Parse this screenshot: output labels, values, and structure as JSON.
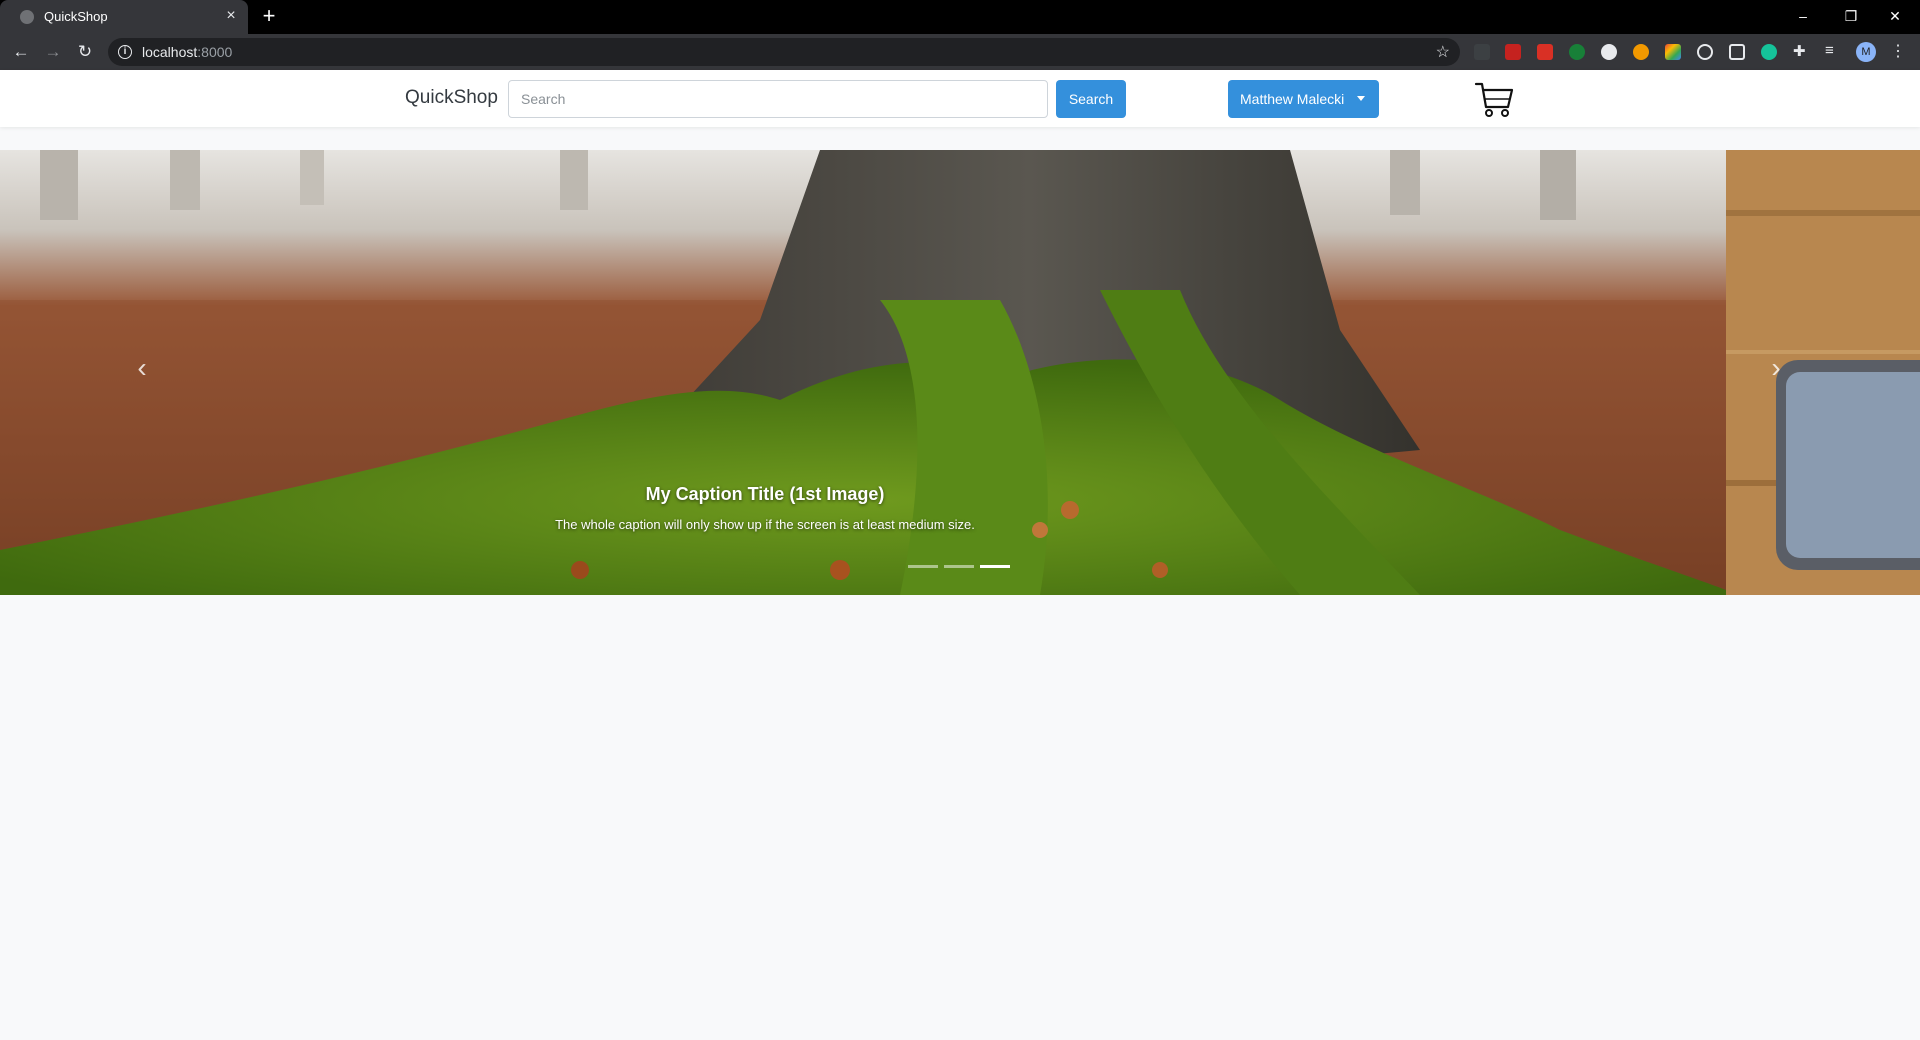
{
  "browser": {
    "tab_title": "QuickShop",
    "tab_close": "×",
    "new_tab": "+",
    "url_host": "localhost",
    "url_port": ":8000",
    "window_controls": {
      "minimize": "–",
      "restore": "❐",
      "close": "✕"
    },
    "profile_initial": "M"
  },
  "navbar": {
    "brand": "QuickShop",
    "search_placeholder": "Search",
    "search_button": "Search",
    "user_name": "Matthew Malecki",
    "cart_icon": "shopping-cart-icon"
  },
  "carousel": {
    "caption_title": "My Caption Title (1st Image)",
    "caption_text": "The whole caption will only show up if the screen is at least medium size.",
    "indicator_count": 3,
    "active_indicator": 3,
    "prev_icon": "chevron-left-icon",
    "next_icon": "chevron-right-icon"
  },
  "colors": {
    "accent": "#3490dc",
    "page_bg": "#f8f9fa",
    "chrome_dark": "#35363a"
  }
}
